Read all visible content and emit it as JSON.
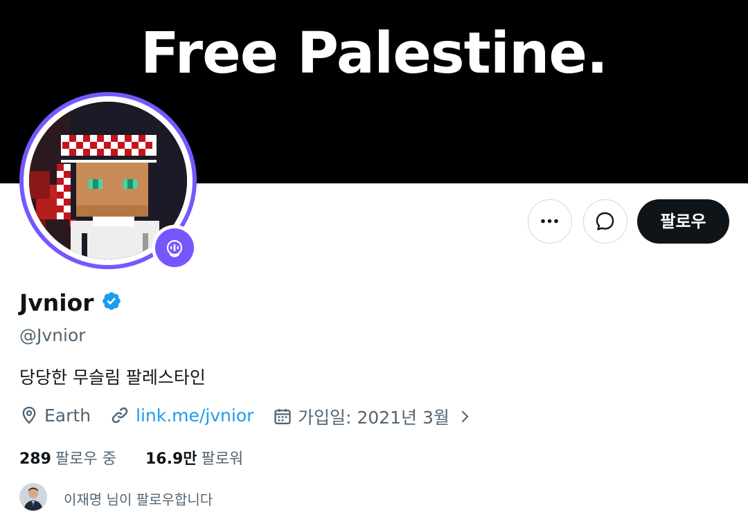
{
  "banner": {
    "text": "Free Palestine."
  },
  "header_buttons": {
    "follow_label": "팔로우"
  },
  "profile": {
    "display_name": "Jvnior",
    "handle": "@Jvnior",
    "bio": "당당한 무슬림 팔레스타인",
    "location": "Earth",
    "website": "link.me/jvnior",
    "joined": "가입일: 2021년 3월"
  },
  "stats": {
    "following_count": "289",
    "following_label": "팔로우 중",
    "followers_count": "16.9만",
    "followers_label": "팔로워"
  },
  "followed_by": {
    "text": "이재명 님이 팔로우합니다"
  },
  "colors": {
    "accent": "#1d9bf0",
    "spaces_ring": "#7856ff",
    "text_primary": "#0f1419",
    "text_secondary": "#536471",
    "banner_bg": "#000000"
  },
  "icons": {
    "more": "more-icon",
    "message": "message-icon",
    "verified": "verified-badge-icon",
    "location": "location-pin-icon",
    "link": "link-icon",
    "calendar": "calendar-icon",
    "chevron": "chevron-right-icon",
    "spaces": "spaces-icon"
  }
}
